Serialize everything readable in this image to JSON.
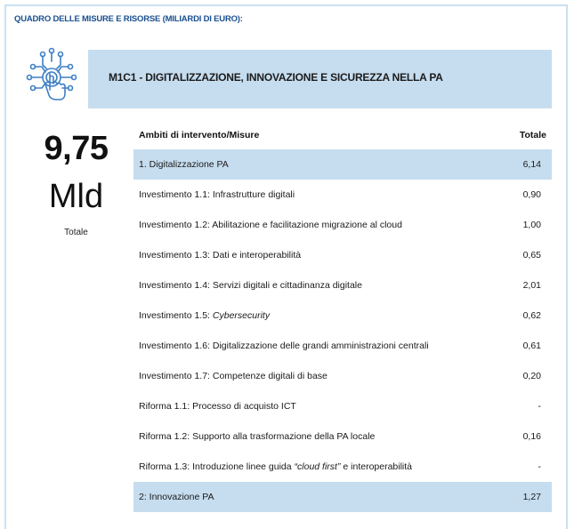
{
  "header": {
    "title": "QUADRO DELLE MISURE E RISORSE (MILIARDI DI EURO):"
  },
  "mission": {
    "title": "M1C1 - DIGITALIZZAZIONE, INNOVAZIONE E SICUREZZA NELLA PA",
    "icon": "digital-touch-icon"
  },
  "summary": {
    "value": "9,75",
    "unit": "Mld",
    "label": "Totale"
  },
  "table": {
    "columns": [
      "Ambiti di intervento/Misure",
      "Totale"
    ],
    "rows": [
      {
        "label": "1. Digitalizzazione PA",
        "value": "6,14",
        "section": true
      },
      {
        "label": "Investimento 1.1: Infrastrutture digitali",
        "value": "0,90"
      },
      {
        "label": "Investimento 1.2: Abilitazione e facilitazione migrazione al cloud",
        "value": "1,00"
      },
      {
        "label": "Investimento 1.3: Dati e interoperabilità",
        "value": "0,65"
      },
      {
        "label": "Investimento 1.4: Servizi digitali e cittadinanza digitale",
        "value": "2,01"
      },
      {
        "label_prefix": "Investimento 1.5: ",
        "label_italic": "Cybersecurity",
        "label_suffix": "",
        "value": "0,62"
      },
      {
        "label": "Investimento 1.6: Digitalizzazione delle grandi amministrazioni centrali",
        "value": "0,61"
      },
      {
        "label": "Investimento 1.7: Competenze digitali di base",
        "value": "0,20"
      },
      {
        "label": "Riforma 1.1: Processo di acquisto ICT",
        "value": "-"
      },
      {
        "label": "Riforma 1.2: Supporto alla trasformazione della PA locale",
        "value": "0,16"
      },
      {
        "label_prefix": "Riforma 1.3: Introduzione linee guida ",
        "label_italic": "“cloud first”",
        "label_suffix": " e interoperabilità",
        "value": "-"
      },
      {
        "label": "2: Innovazione PA",
        "value": "1,27",
        "section": true
      }
    ]
  },
  "colors": {
    "accent_light": "#c6ddef",
    "title_blue": "#1a4f8f",
    "icon_blue": "#3d7fc4"
  }
}
